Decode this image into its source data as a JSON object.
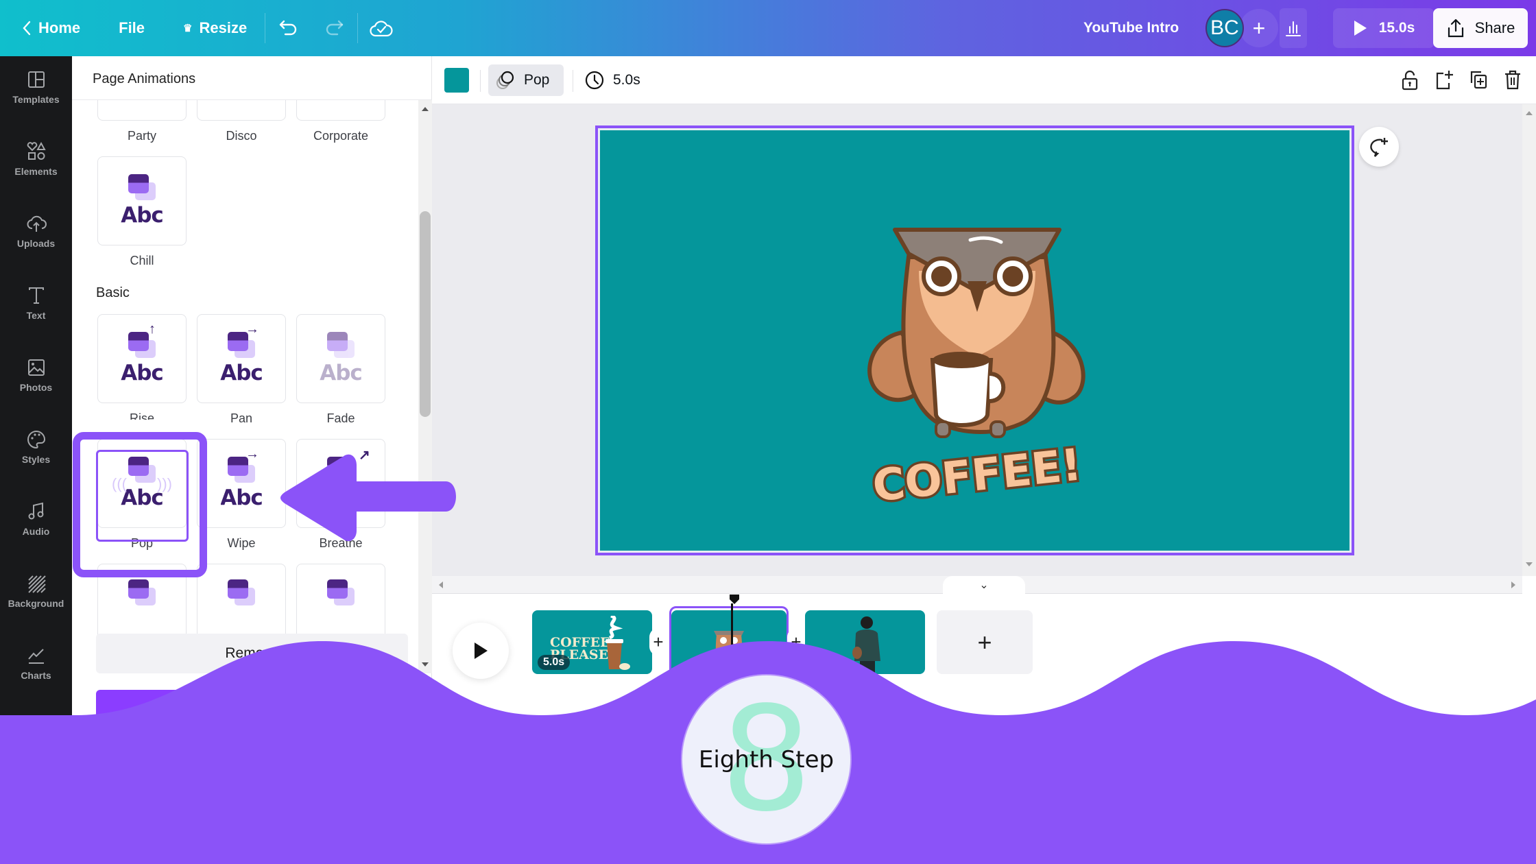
{
  "topbar": {
    "home_label": "Home",
    "file_label": "File",
    "resize_label": "Resize",
    "design_title": "YouTube Intro",
    "avatar_initials": "BC",
    "add_collaborator": "+",
    "play_duration": "15.0s",
    "share_label": "Share"
  },
  "rail": {
    "items": [
      {
        "label": "Templates",
        "icon": "templates-icon"
      },
      {
        "label": "Elements",
        "icon": "elements-icon"
      },
      {
        "label": "Uploads",
        "icon": "uploads-icon"
      },
      {
        "label": "Text",
        "icon": "text-icon"
      },
      {
        "label": "Photos",
        "icon": "photos-icon"
      },
      {
        "label": "Styles",
        "icon": "styles-icon"
      },
      {
        "label": "Audio",
        "icon": "audio-icon"
      },
      {
        "label": "Background",
        "icon": "background-icon"
      },
      {
        "label": "Charts",
        "icon": "charts-icon"
      }
    ]
  },
  "panel": {
    "title": "Page Animations",
    "top_row": [
      "Party",
      "Disco",
      "Corporate"
    ],
    "chill_label": "Chill",
    "sample_text": "Abc",
    "basic_section": "Basic",
    "basic": [
      {
        "label": "Rise",
        "arrow": "↑"
      },
      {
        "label": "Pan",
        "arrow": "→"
      },
      {
        "label": "Fade",
        "arrow": ""
      },
      {
        "label": "Pop",
        "arrow": "",
        "selected": true
      },
      {
        "label": "Wipe",
        "arrow": "→"
      },
      {
        "label": "Breathe",
        "arrow": "↗"
      }
    ],
    "remove_label": "Remove"
  },
  "editor_toolbar": {
    "bg_color": "#05969b",
    "animation_label": "Pop",
    "duration": "5.0s"
  },
  "canvas": {
    "headline": "COFFEE!",
    "bg_color": "#05969b"
  },
  "timeline": {
    "pages": [
      {
        "title_art": "COFFEE PLEASE",
        "duration": "5.0s"
      },
      {
        "title_art": "owl",
        "selected": true
      },
      {
        "title_art": "person"
      }
    ],
    "add_page": "+",
    "gap_add": "+"
  },
  "overlay": {
    "step_number": "8",
    "step_text": "Eighth Step",
    "accent": "#8b53f8"
  }
}
